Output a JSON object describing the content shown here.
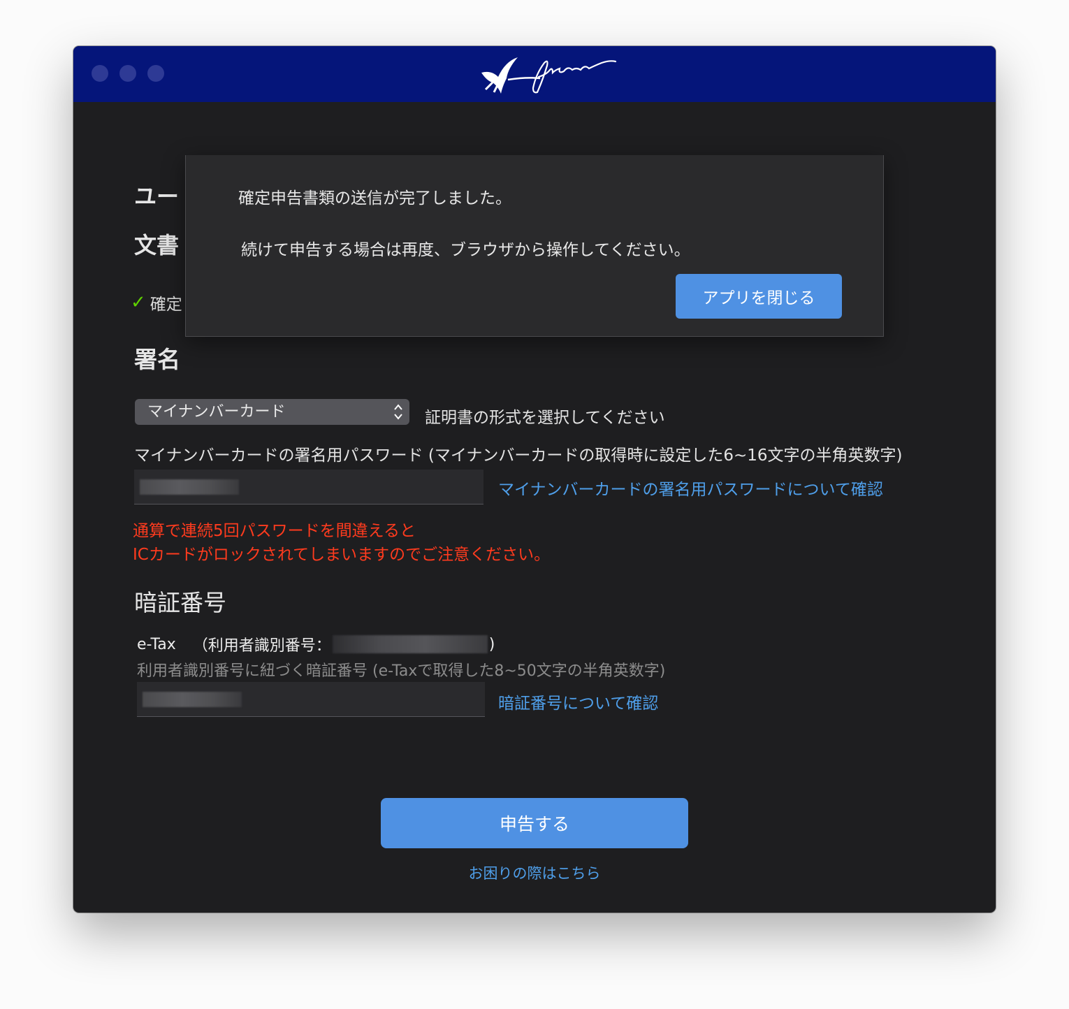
{
  "app": {
    "brand": "freee",
    "accent_color": "#4f91e3",
    "titlebar_color": "#05157a",
    "link_color": "#4f9fea",
    "warning_color": "#ff3b1e"
  },
  "background_sections": {
    "user_heading": "ユー",
    "document_heading": "文書",
    "confirm_item": "確定"
  },
  "signature": {
    "heading": "署名",
    "cert_type_selected": "マイナンバーカード",
    "cert_type_hint": "証明書の形式を選択してください",
    "password_label": "マイナンバーカードの署名用パスワード (マイナンバーカードの取得時に設定した6~16文字の半角英数字)",
    "password_help_link": "マイナンバーカードの署名用パスワードについて確認",
    "warning_line1": "通算で連続5回パスワードを間違えると",
    "warning_line2": "ICカードがロックされてしまいますのでご注意ください。"
  },
  "pin": {
    "heading": "暗証番号",
    "etax_label": "e-Tax",
    "user_id_prefix": "（利用者識別番号：",
    "user_id_suffix": ")",
    "hint": "利用者識別番号に紐づく暗証番号 (e-Taxで取得した8~50文字の半角英数字)",
    "help_link": "暗証番号について確認"
  },
  "actions": {
    "submit_label": "申告する",
    "help_label": "お困りの際はこちら"
  },
  "modal": {
    "message1": "確定申告書類の送信が完了しました。",
    "message2": "続けて申告する場合は再度、ブラウザから操作してください。",
    "close_button": "アプリを閉じる"
  },
  "icons": {
    "check": "check-icon",
    "select_arrows": "chevron-updown-icon",
    "logo": "freee-swallow-logo"
  }
}
